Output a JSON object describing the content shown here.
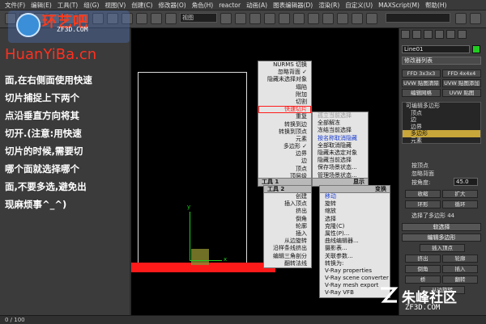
{
  "menubar": {
    "items": [
      "文件(F)",
      "编辑(E)",
      "工具(T)",
      "组(G)",
      "视图(V)",
      "创建(C)",
      "修改器(O)",
      "角色(H)",
      "reactor",
      "动画(A)",
      "图表编辑器(D)",
      "渲染(R)",
      "自定义(U)",
      "MAXScript(M)",
      "帮助(H)"
    ]
  },
  "toolbar": {
    "view_select": "视图",
    "right_select": ""
  },
  "watermark": {
    "brand_cn": "环艺吧",
    "brand_url": "ZF3D.COM",
    "site": "HuanYiBa.cn"
  },
  "instructions": {
    "lines": [
      "面,在右侧面使用快速",
      "切片捕捉上下两个",
      "点沿垂直方向将其",
      "切开.(注意:用快速",
      "切片的时候,需要切",
      "哪个面就选择哪个",
      "面,不要多选,避免出",
      "现麻烦事^_^)"
    ]
  },
  "viewport": {
    "label": "",
    "axis_y": "y",
    "axis_x": "x"
  },
  "quad_menu": {
    "top_left": [
      {
        "label": "NURMS 切换",
        "style": ""
      },
      {
        "label": "忽略背面 ✓",
        "style": ""
      },
      {
        "label": "隐藏未选择对象",
        "style": ""
      },
      {
        "label": "塌陷",
        "style": ""
      },
      {
        "label": "附加",
        "style": ""
      },
      {
        "label": "切割",
        "style": ""
      },
      {
        "label": "快速切片",
        "style": "hl"
      },
      {
        "label": "重复",
        "style": ""
      },
      {
        "label": "转换到边",
        "style": ""
      },
      {
        "label": "转换到顶点",
        "style": ""
      },
      {
        "label": "元素",
        "style": ""
      },
      {
        "label": "多边形 ✓",
        "style": ""
      },
      {
        "label": "边界",
        "style": ""
      },
      {
        "label": "边",
        "style": ""
      },
      {
        "label": "顶点",
        "style": ""
      },
      {
        "label": "顶层级",
        "style": ""
      }
    ],
    "top_right": [
      {
        "label": "孤立当前选择",
        "style": "gray"
      },
      {
        "label": "全部解冻",
        "style": ""
      },
      {
        "label": "冻结当前选择",
        "style": ""
      },
      {
        "label": "按名称取消隐藏",
        "style": "blue"
      },
      {
        "label": "全部取消隐藏",
        "style": ""
      },
      {
        "label": "隐藏未选定对象",
        "style": ""
      },
      {
        "label": "隐藏当前选择",
        "style": ""
      },
      {
        "label": "保存场景状态...",
        "style": ""
      },
      {
        "label": "管理场景状态...",
        "style": ""
      }
    ],
    "header_tools1": "工具 1",
    "header_display": "显示",
    "header_tools2": "工具 2",
    "header_transform": "变换",
    "bottom_left": [
      {
        "label": "创建",
        "style": ""
      },
      {
        "label": "插入顶点",
        "style": ""
      },
      {
        "label": "挤出",
        "style": ""
      },
      {
        "label": "倒角",
        "style": ""
      },
      {
        "label": "轮廓",
        "style": ""
      },
      {
        "label": "插入",
        "style": ""
      },
      {
        "label": "从边旋转",
        "style": ""
      },
      {
        "label": "沿样条线挤出",
        "style": ""
      },
      {
        "label": "编辑三角剖分",
        "style": ""
      },
      {
        "label": "翻转法线",
        "style": ""
      }
    ],
    "bottom_right": [
      {
        "label": "移动",
        "style": "blue"
      },
      {
        "label": "旋转",
        "style": ""
      },
      {
        "label": "缩放",
        "style": ""
      },
      {
        "label": "选择",
        "style": ""
      },
      {
        "label": "克隆(C)",
        "style": ""
      },
      {
        "label": "属性(P)...",
        "style": ""
      },
      {
        "label": "曲线编辑器...",
        "style": ""
      },
      {
        "label": "摄影表...",
        "style": ""
      },
      {
        "label": "关联参数...",
        "style": ""
      },
      {
        "label": "转换为:",
        "style": ""
      },
      {
        "label": "V-Ray properties",
        "style": ""
      },
      {
        "label": "V-Ray scene converter",
        "style": ""
      },
      {
        "label": "V-Ray mesh export",
        "style": ""
      },
      {
        "label": "V-Ray VFB",
        "style": ""
      }
    ]
  },
  "right_panel": {
    "object_name": "Line01",
    "modifier_list": "修改器列表",
    "btn_ffd333": "FFD 3x3x3",
    "btn_ffd444": "FFD 4x4x4",
    "btn_uvw_clear": "UVW 贴图清除",
    "btn_uvw_add": "UVW 贴图添加",
    "btn_edit_mesh": "编辑网格",
    "btn_uvw_map": "UVW 贴图",
    "stack_title": "可编辑多边形",
    "stack_items": [
      "顶点",
      "边",
      "边界",
      "多边形",
      "元素"
    ],
    "by_vertex": "按顶点",
    "ignore_backface": "忽略背面",
    "by_angle": "按角度:",
    "angle_value": "45.0",
    "shrink": "收缩",
    "grow": "扩大",
    "ring": "环形",
    "loop": "循环",
    "selected_count": "选择了多边形 44",
    "soft_select": "软选择",
    "edit_polygons": "编辑多边形",
    "insert_vertex": "插入顶点",
    "extrude": "挤出",
    "outline": "轮廓",
    "bevel": "倒角",
    "inset": "插入",
    "bridge": "桥",
    "flip": "翻转",
    "hinge": "从边旋转"
  },
  "status": {
    "frame": "0 / 100"
  },
  "footer_brand": {
    "name": "朱峰社区",
    "url": "ZF3D.COM"
  }
}
